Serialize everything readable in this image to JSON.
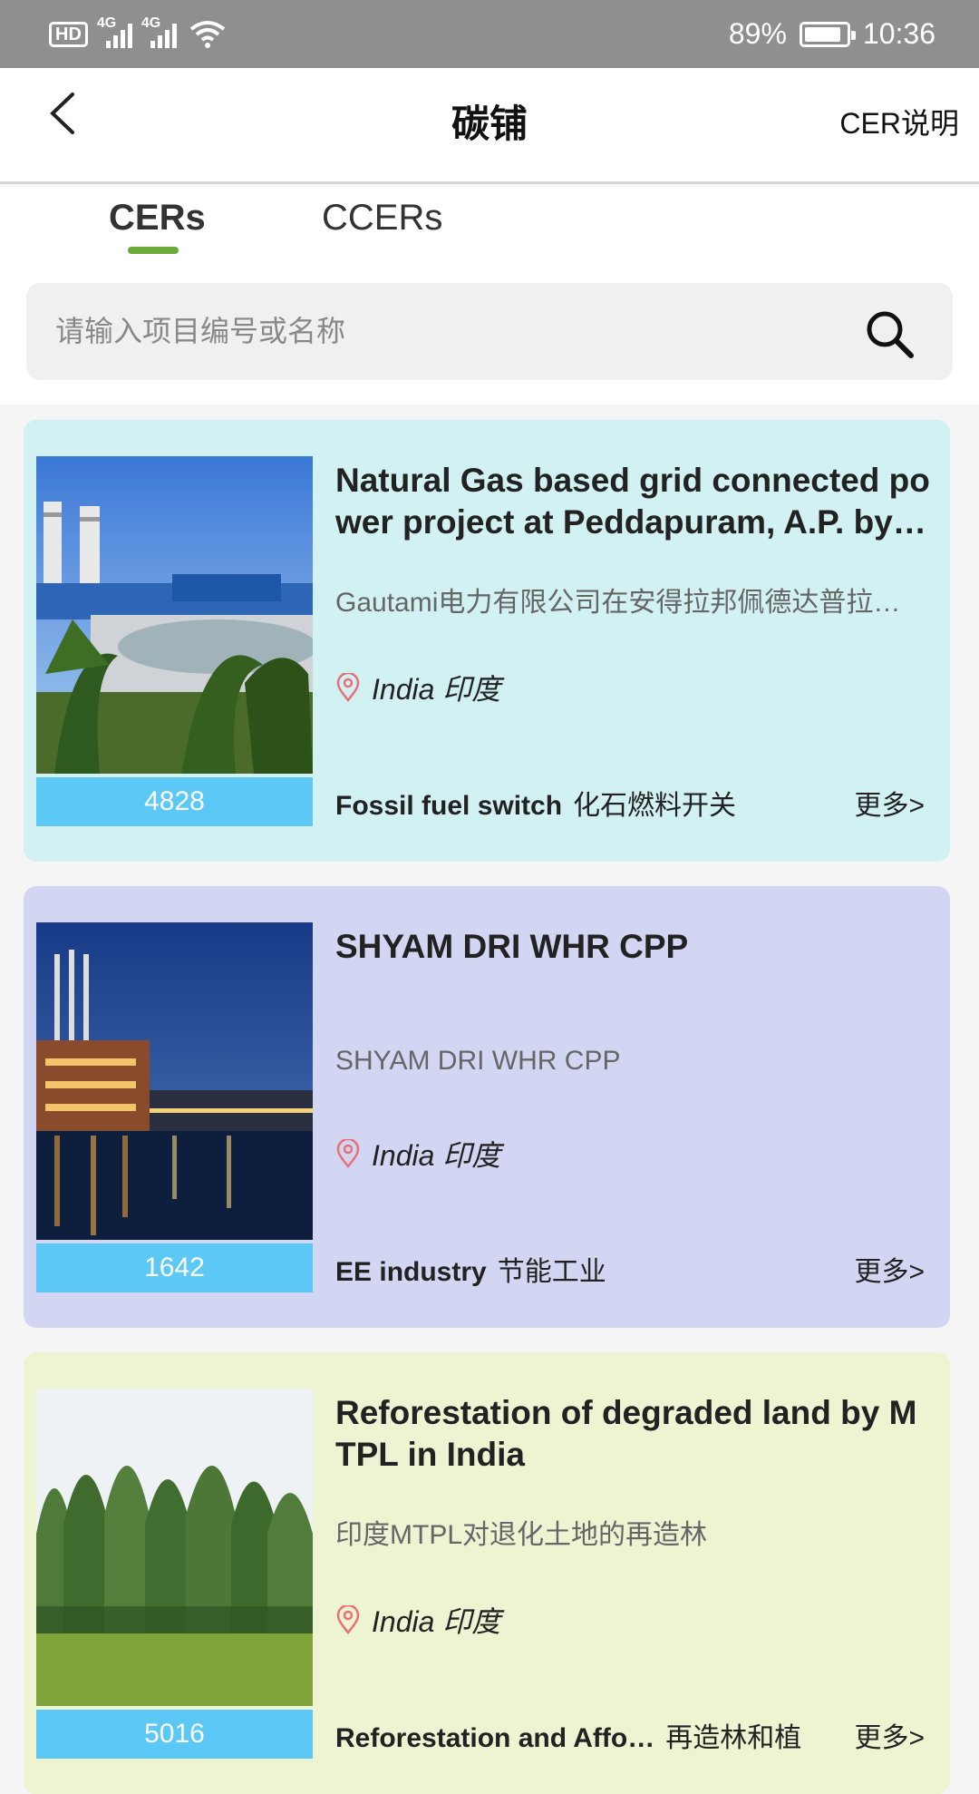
{
  "status_bar": {
    "battery": "89%",
    "time": "10:36",
    "hd": "HD",
    "sim1": "4G",
    "sim2": "4G"
  },
  "header": {
    "title": "碳铺",
    "right_link": "CER说明"
  },
  "tabs": [
    {
      "label": "CERs",
      "active": true
    },
    {
      "label": "CCERs",
      "active": false
    }
  ],
  "search": {
    "placeholder": "请输入项目编号或名称",
    "value": ""
  },
  "cards": [
    {
      "title": "Natural Gas based grid connected power project at Peddapuram, A.P. by …",
      "subtitle": "Gautami电力有限公司在安得拉邦佩德达普拉…",
      "location": "India 印度",
      "count": "4828",
      "category_en": "Fossil fuel switch",
      "category_cn": "化石燃料开关",
      "more": "更多>",
      "bg": "#d2f1f2"
    },
    {
      "title": "SHYAM DRI WHR CPP",
      "subtitle": "SHYAM DRI WHR CPP",
      "location": "India 印度",
      "count": "1642",
      "category_en": "EE industry",
      "category_cn": "节能工业",
      "more": "更多>",
      "bg": "#d3d6f3"
    },
    {
      "title": "Reforestation of degraded land by MTPL in India",
      "subtitle": "印度MTPL对退化土地的再造林",
      "location": "India 印度",
      "count": "5016",
      "category_en": "Reforestation and Affo…",
      "category_cn": "再造林和植",
      "more": "更多>",
      "bg": "#eef3d2"
    }
  ],
  "colors": {
    "accent": "#6aaa3a",
    "count_bar": "#5bc8f5",
    "pin": "#e8707a"
  }
}
